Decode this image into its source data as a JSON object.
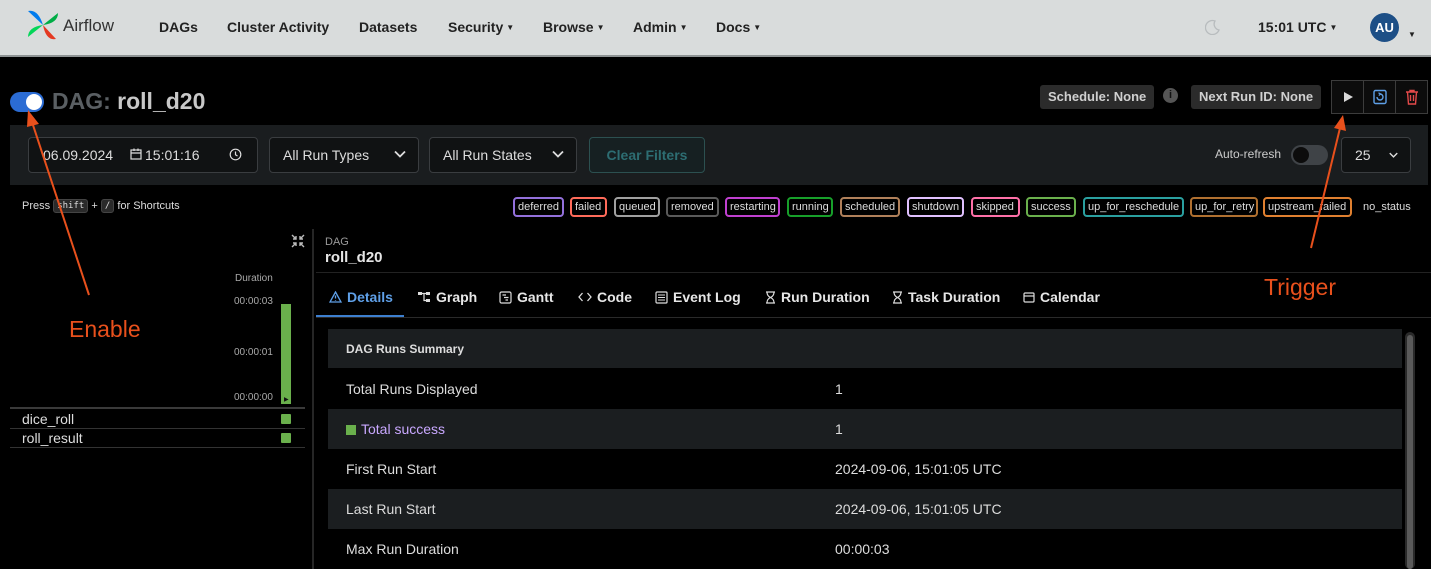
{
  "navbar": {
    "brand": "Airflow",
    "items": [
      {
        "label": "DAGs",
        "dropdown": false
      },
      {
        "label": "Cluster Activity",
        "dropdown": false
      },
      {
        "label": "Datasets",
        "dropdown": false
      },
      {
        "label": "Security",
        "dropdown": true
      },
      {
        "label": "Browse",
        "dropdown": true
      },
      {
        "label": "Admin",
        "dropdown": true
      },
      {
        "label": "Docs",
        "dropdown": true
      }
    ],
    "time": "15:01 UTC",
    "avatar_initials": "AU",
    "theme_icon": "moon-icon"
  },
  "dag": {
    "prefix": "DAG:",
    "name": "roll_d20",
    "enabled": true,
    "schedule": "Schedule: None",
    "next_run": "Next Run ID: None",
    "actions": [
      "play-icon",
      "reparse-icon",
      "trash-icon"
    ]
  },
  "filters": {
    "date": "06.09.2024",
    "time": "15:01:16",
    "run_types": "All Run Types",
    "run_states": "All Run States",
    "clear_label": "Clear Filters",
    "auto_refresh_label": "Auto-refresh",
    "auto_refresh_on": false,
    "page_size": "25"
  },
  "shortcuts": {
    "press": "Press",
    "key1": "shift",
    "plus": "+",
    "key2": "/",
    "suffix": "for Shortcuts"
  },
  "legend": [
    {
      "label": "deferred",
      "color": "#9370db"
    },
    {
      "label": "failed",
      "color": "#ff6b5a"
    },
    {
      "label": "queued",
      "color": "#a0a0a0"
    },
    {
      "label": "removed",
      "color": "#5a5a5a"
    },
    {
      "label": "restarting",
      "color": "#c040d0"
    },
    {
      "label": "running",
      "color": "#17a02a"
    },
    {
      "label": "scheduled",
      "color": "#b0805a"
    },
    {
      "label": "shutdown",
      "color": "#e0c0ff"
    },
    {
      "label": "skipped",
      "color": "#ff70a8"
    },
    {
      "label": "success",
      "color": "#6ab04c"
    },
    {
      "label": "up_for_reschedule",
      "color": "#2aa0a0"
    },
    {
      "label": "up_for_retry",
      "color": "#b07030"
    },
    {
      "label": "upstream_failed",
      "color": "#e08030"
    },
    {
      "label": "no_status",
      "color": "#000000"
    }
  ],
  "grid": {
    "duration_label": "Duration",
    "duration_ticks": [
      "00:00:03",
      "00:00:01",
      "00:00:00"
    ],
    "run_duration_fraction": 1.0,
    "tasks": [
      {
        "name": "dice_roll",
        "state": "success"
      },
      {
        "name": "roll_result",
        "state": "success"
      }
    ]
  },
  "details": {
    "dag_label": "DAG",
    "dag_name": "roll_d20",
    "tabs": [
      {
        "label": "Details",
        "icon": "warning-triangle-icon",
        "active": true
      },
      {
        "label": "Graph",
        "icon": "graph-icon",
        "active": false
      },
      {
        "label": "Gantt",
        "icon": "gantt-icon",
        "active": false
      },
      {
        "label": "Code",
        "icon": "code-icon",
        "active": false
      },
      {
        "label": "Event Log",
        "icon": "event-log-icon",
        "active": false
      },
      {
        "label": "Run Duration",
        "icon": "hourglass-icon",
        "active": false
      },
      {
        "label": "Task Duration",
        "icon": "hourglass-icon",
        "active": false
      },
      {
        "label": "Calendar",
        "icon": "calendar-icon",
        "active": false
      }
    ],
    "summary_title": "DAG Runs Summary",
    "rows": [
      {
        "key": "Total Runs Displayed",
        "value": "1"
      },
      {
        "key": "Total success",
        "value": "1"
      },
      {
        "key": "First Run Start",
        "value": "2024-09-06, 15:01:05 UTC"
      },
      {
        "key": "Last Run Start",
        "value": "2024-09-06, 15:01:05 UTC"
      },
      {
        "key": "Max Run Duration",
        "value": "00:00:03"
      }
    ],
    "success_color": "#6ab04c",
    "success_text_color": "#c9a8ff"
  },
  "annotations": {
    "enable": "Enable",
    "trigger": "Trigger",
    "color": "#e8501c"
  }
}
